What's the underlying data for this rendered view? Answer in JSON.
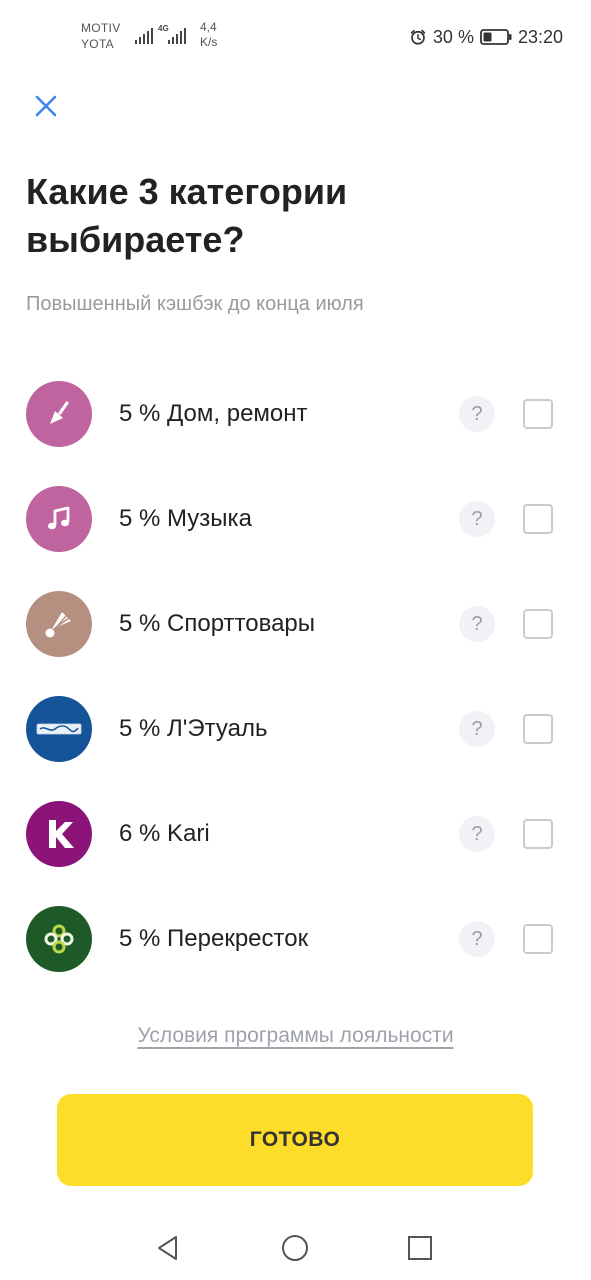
{
  "status_bar": {
    "carrier_line1": "MOTIV",
    "carrier_line2": "YOTA",
    "network_type": "4G",
    "speed_value": "4,4",
    "speed_unit": "K/s",
    "battery_percent": "30 %",
    "time": "23:20"
  },
  "title": "Какие 3 категории выбираете?",
  "subtitle": "Повышенный кэшбэк до конца июля",
  "categories": [
    {
      "label": "5 % Дом, ремонт",
      "icon": "trowel-icon",
      "color": "#c0649f",
      "checked": false
    },
    {
      "label": "5 % Музыка",
      "icon": "music-note-icon",
      "color": "#c0649f",
      "checked": false
    },
    {
      "label": "5 % Спорттовары",
      "icon": "shuttlecock-icon",
      "color": "#b58f80",
      "checked": false
    },
    {
      "label": "5 % Л'Этуаль",
      "icon": "letual-logo",
      "color": "#16549a",
      "checked": false
    },
    {
      "label": "6 % Kari",
      "icon": "kari-logo",
      "color": "#8c1377",
      "checked": false
    },
    {
      "label": "5 % Перекресток",
      "icon": "perekrestok-logo",
      "color": "#1e5a27",
      "checked": false
    }
  ],
  "help_symbol": "?",
  "terms_link": "Условия программы лояльности",
  "done_button": "ГОТОВО",
  "colors": {
    "accent_yellow": "#fedc2a",
    "close_blue": "#3f85ea",
    "muted_text": "#9a9a9f"
  }
}
